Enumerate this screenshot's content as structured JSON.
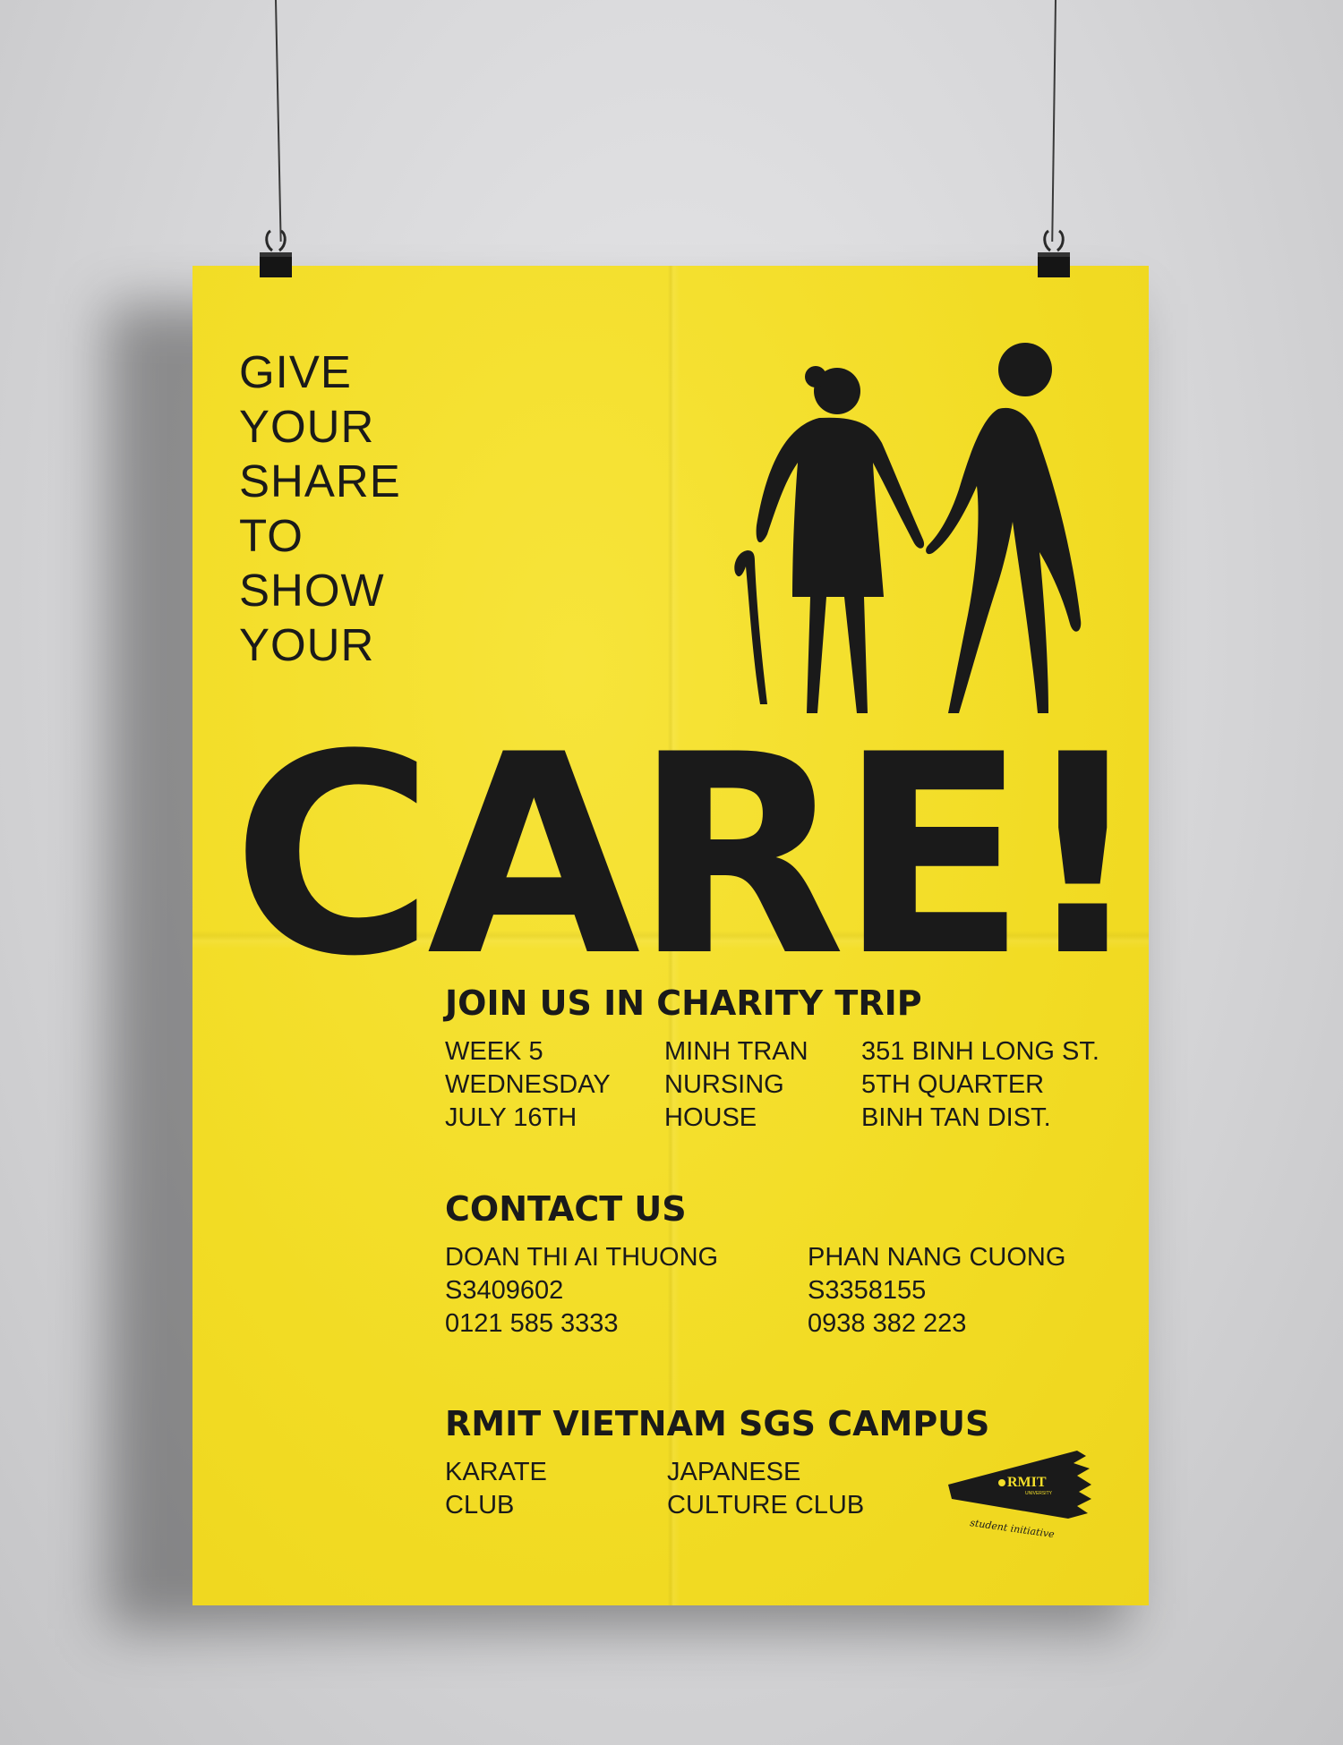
{
  "poster": {
    "background_color": "#f4df2a",
    "ink_color": "#1a1a1a",
    "tagline": [
      "GIVE",
      "YOUR",
      "SHARE",
      "TO",
      "SHOW",
      "YOUR"
    ],
    "headline": "CARE!",
    "illustration": "elderly-couple-holding-hands-icon",
    "event": {
      "heading": "JOIN US IN CHARITY TRIP",
      "when": [
        "WEEK 5",
        "WEDNESDAY",
        "JULY 16TH"
      ],
      "place": [
        "MINH TRAN",
        "NURSING",
        "HOUSE"
      ],
      "address": [
        "351 BINH LONG ST.",
        "5TH QUARTER",
        "BINH TAN DIST."
      ]
    },
    "contact": {
      "heading": "CONTACT US",
      "people": [
        {
          "name": "DOAN THI AI THUONG",
          "id": "S3409602",
          "phone": "0121 585 3333"
        },
        {
          "name": "PHAN NANG CUONG",
          "id": "S3358155",
          "phone": "0938 382 223"
        }
      ]
    },
    "organizer": {
      "heading": "RMIT VIETNAM SGS CAMPUS",
      "club_1": [
        "KARATE",
        "CLUB"
      ],
      "club_2": [
        "JAPANESE",
        "CULTURE CLUB"
      ],
      "logo_text": "RMIT",
      "logo_subtext": "UNIVERSITY",
      "logo_script": "student initiative"
    }
  }
}
